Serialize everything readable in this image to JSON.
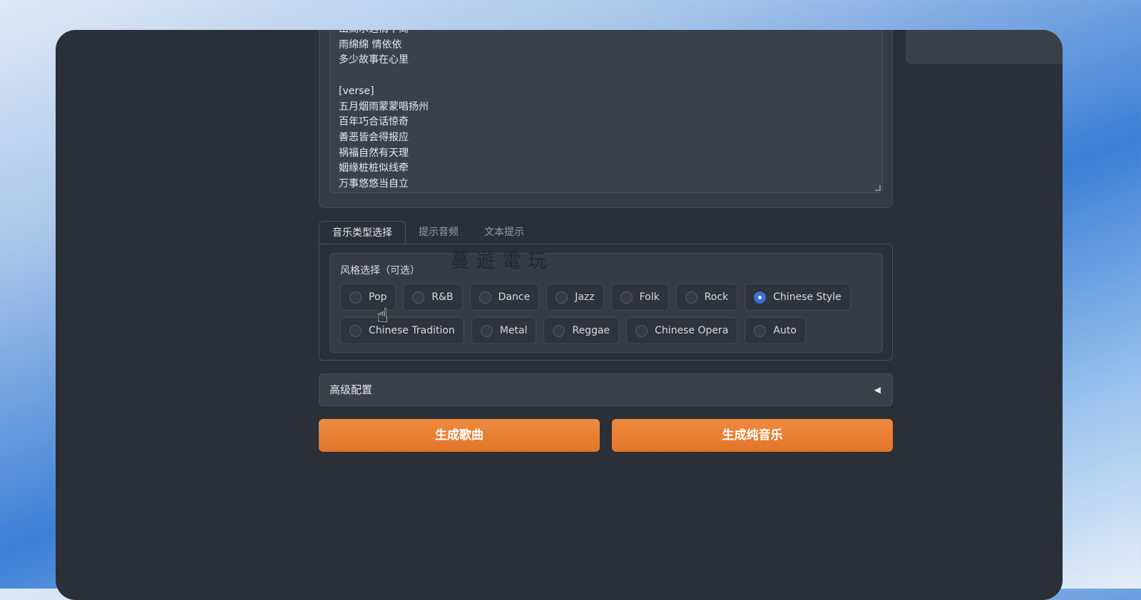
{
  "lyrics": {
    "lines": [
      "山高水远情不离",
      "雨绵绵 情依依",
      "多少故事在心里",
      "",
      "[verse]",
      "五月烟雨蒙蒙唱扬州",
      "百年巧合话惊奇",
      "善恶皆会得报应",
      "祸福自然有天理",
      "姻缘桩桩似线牵",
      "万事悠悠当自立"
    ]
  },
  "tabs": [
    "音乐类型选择",
    "提示音频",
    "文本提示"
  ],
  "style_group": {
    "label": "风格选择（可选）",
    "options_row1": [
      "Pop",
      "R&B",
      "Dance",
      "Jazz",
      "Folk",
      "Rock",
      "Chinese Style"
    ],
    "options_row2": [
      "Chinese Tradition",
      "Metal",
      "Reggae",
      "Chinese Opera",
      "Auto"
    ],
    "selected": "Chinese Style"
  },
  "advanced": {
    "label": "高级配置",
    "arrow": "◀"
  },
  "buttons": {
    "generate_song": "生成歌曲",
    "generate_music": "生成纯音乐"
  },
  "watermark": "蔓遊電玩",
  "colors": {
    "accent": "#e97f33",
    "radio_selected": "#3b6fd4"
  }
}
